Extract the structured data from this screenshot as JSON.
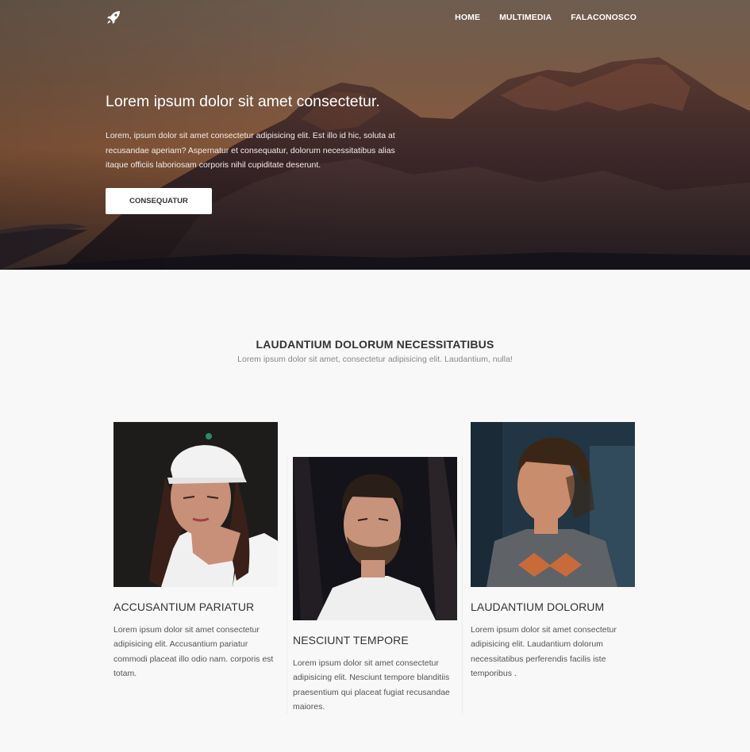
{
  "nav": {
    "logo_icon": "rocket-icon",
    "items": [
      "HOME",
      "MULTIMEDIA",
      "FALACONOSCO"
    ]
  },
  "hero": {
    "title": "Lorem ipsum dolor sit amet consectetur.",
    "text": "Lorem, ipsum dolor sit amet consectetur adipisicing elit. Est illo id hic, soluta at recusandae aperiam? Aspernatur et consequatur, dolorum necessitatibus alias itaque officiis laboriosam corporis nihil cupiditate deserunt.",
    "button": "CONSEQUATUR"
  },
  "section": {
    "title": "LAUDANTIUM DOLORUM NECESSITATIBUS",
    "subtitle": "Lorem ipsum dolor sit amet, consectetur adipisicing elit. Laudantium, nulla!"
  },
  "cards": [
    {
      "title": "ACCUSANTIUM PARIATUR",
      "text": "Lorem ipsum dolor sit amet consectetur adipisicing elit. Accusantium pariatur commodi placeat illo odio nam. corporis est totam."
    },
    {
      "title": "NESCIUNT TEMPORE",
      "text": "Lorem ipsum dolor sit amet consectetur adipisicing elit. Nesciunt tempore blanditiis praesentium qui placeat fugiat recusandae maiores."
    },
    {
      "title": "LAUDANTIUM DOLORUM",
      "text": "Lorem ipsum dolor sit amet consectetur adipisicing elit. Laudantium dolorum necessitatibus perferendis facilis iste temporibus ."
    }
  ]
}
